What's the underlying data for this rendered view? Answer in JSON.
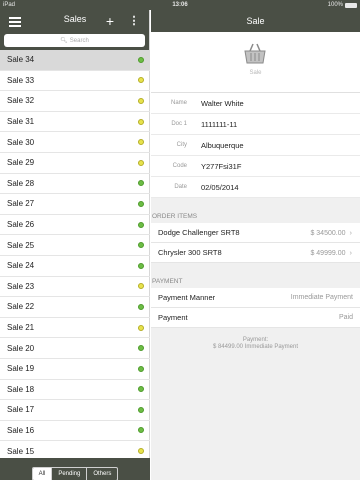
{
  "status_bar": {
    "carrier": "iPad",
    "time": "13:06",
    "battery": "100%"
  },
  "master": {
    "title": "Sales",
    "search_placeholder": "Search",
    "items": [
      {
        "label": "Sale 34",
        "status": "green",
        "selected": true
      },
      {
        "label": "Sale 33",
        "status": "yellow"
      },
      {
        "label": "Sale 32",
        "status": "yellow"
      },
      {
        "label": "Sale 31",
        "status": "yellow"
      },
      {
        "label": "Sale 30",
        "status": "yellow"
      },
      {
        "label": "Sale 29",
        "status": "yellow"
      },
      {
        "label": "Sale 28",
        "status": "green"
      },
      {
        "label": "Sale 27",
        "status": "green"
      },
      {
        "label": "Sale 26",
        "status": "green"
      },
      {
        "label": "Sale 25",
        "status": "green"
      },
      {
        "label": "Sale 24",
        "status": "green"
      },
      {
        "label": "Sale 23",
        "status": "yellow"
      },
      {
        "label": "Sale 22",
        "status": "green"
      },
      {
        "label": "Sale 21",
        "status": "yellow"
      },
      {
        "label": "Sale 20",
        "status": "green"
      },
      {
        "label": "Sale 19",
        "status": "green"
      },
      {
        "label": "Sale 18",
        "status": "green"
      },
      {
        "label": "Sale 17",
        "status": "green"
      },
      {
        "label": "Sale 16",
        "status": "green"
      },
      {
        "label": "Sale 15",
        "status": "yellow"
      }
    ],
    "filters": [
      {
        "label": "All",
        "active": true
      },
      {
        "label": "Pending",
        "active": false
      },
      {
        "label": "Others",
        "active": false
      }
    ]
  },
  "detail": {
    "title": "Sale",
    "icon_caption": "Sale",
    "fields": {
      "name": {
        "label": "Name",
        "value": "Walter White"
      },
      "doc": {
        "label": "Doc 1",
        "value": "1111111-11"
      },
      "city": {
        "label": "City",
        "value": "Albuquerque"
      },
      "code": {
        "label": "Code",
        "value": "Y277Fsi31F"
      },
      "date": {
        "label": "Date",
        "value": "02/05/2014"
      }
    },
    "order_items_title": "ORDER ITEMS",
    "order_items": [
      {
        "name": "Dodge Challenger SRT8",
        "price": "$ 34500.00"
      },
      {
        "name": "Chrysler 300 SRT8",
        "price": "$ 49999.00"
      }
    ],
    "payment_title": "PAYMENT",
    "payment_manner": {
      "label": "Payment Manner",
      "value": "Immediate Payment"
    },
    "payment_status": {
      "label": "Payment",
      "value": "Paid"
    },
    "summary_line1": "Payment:",
    "summary_line2": "$ 84499.00 Immediate Payment"
  },
  "colors": {
    "header_bg": "#4a4f45",
    "status_green": "#6dbd45",
    "status_yellow": "#e7e24c"
  }
}
